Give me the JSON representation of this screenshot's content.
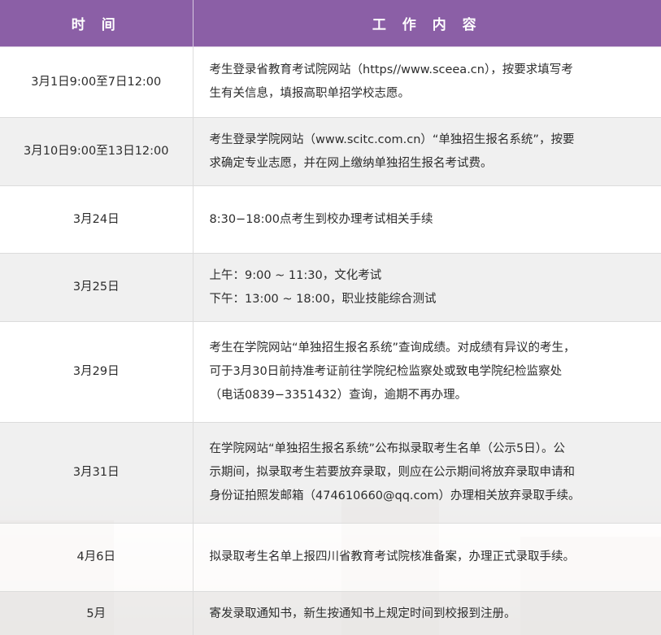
{
  "header": {
    "time": "时 间",
    "work": "工 作 内 容"
  },
  "rows": [
    {
      "time": "3月1日9:00至7日12:00",
      "lines": [
        "考生登录省教育考试院网站（https//www.sceea.cn），按要求填写考",
        "生有关信息，填报高职单招学校志愿。"
      ]
    },
    {
      "time": "3月10日9:00至13日12:00",
      "lines": [
        "考生登录学院网站（www.scitc.com.cn）“单独招生报名系统”，按要",
        "求确定专业志愿，并在网上缴纳单独招生报名考试费。"
      ]
    },
    {
      "time": "3月24日",
      "lines": [
        "8:30−18:00点考生到校办理考试相关手续"
      ]
    },
    {
      "time": "3月25日",
      "lines": [
        "上午：9:00 ~ 11:30，文化考试",
        "下午：13:00 ~ 18:00，职业技能综合测试"
      ]
    },
    {
      "time": "3月29日",
      "lines": [
        "考生在学院网站“单独招生报名系统”查询成绩。对成绩有异议的考生，",
        "可于3月30日前持准考证前往学院纪检监察处或致电学院纪检监察处",
        "（电话0839−3351432）查询，逾期不再办理。"
      ]
    },
    {
      "time": "3月31日",
      "lines": [
        "在学院网站“单独招生报名系统”公布拟录取考生名单（公示5日）。公",
        "示期间，拟录取考生若要放弃录取，则应在公示期间将放弃录取申请和",
        "身份证拍照发邮箱（474610660@qq.com）办理相关放弃录取手续。"
      ]
    },
    {
      "time": "4月6日",
      "lines": [
        "拟录取考生名单上报四川省教育考试院核准备案，办理正式录取手续。"
      ]
    },
    {
      "time": "5月",
      "lines": [
        "寄发录取通知书，新生按通知书上规定时间到校报到注册。"
      ]
    }
  ]
}
